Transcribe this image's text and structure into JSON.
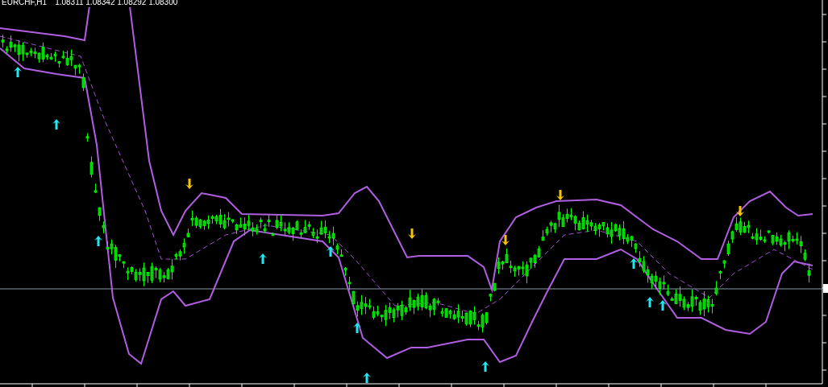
{
  "chart_header": {
    "symbol": "EURCHF,H1",
    "prices": "1.08311 1.08342 1.08292 1.08300"
  }
}
